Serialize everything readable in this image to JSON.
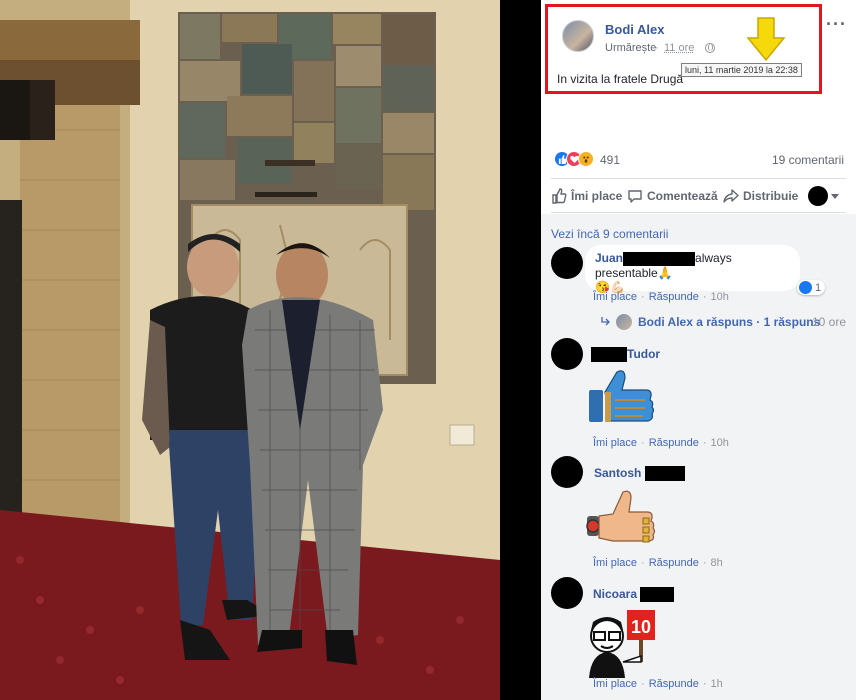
{
  "post": {
    "author": "Bodi Alex",
    "follow": "Urmărește",
    "dot": "·",
    "time": "11 ore",
    "tooltip": "luni, 11 martie 2019 la 22:38",
    "text": "In vizita la fratele Drugă"
  },
  "stats": {
    "reactions": "491",
    "comments": "19 comentarii"
  },
  "actions": {
    "like": "Îmi place",
    "comment": "Comentează",
    "share": "Distribuie"
  },
  "comments": {
    "see_more": "Vezi încă 9 comentarii",
    "c1": {
      "name": "Juan",
      "text": "always presentable🙏",
      "emoji": "😘💪🏻",
      "like": "Îmi place",
      "reply": "Răspunde",
      "age": "10h",
      "likes": "1"
    },
    "reply_row": {
      "text": "Bodi Alex a răspuns · 1 răspuns",
      "age": "10 ore"
    },
    "c2": {
      "name": "Tudor",
      "like": "Îmi place",
      "reply": "Răspunde",
      "age": "10h"
    },
    "c3": {
      "name": "Santosh",
      "like": "Îmi place",
      "reply": "Răspunde",
      "age": "8h"
    },
    "c4": {
      "name": "Nicoara",
      "like": "Îmi place",
      "reply": "Răspunde",
      "age": "1h",
      "sticker_text": "10"
    }
  },
  "colors": {
    "link": "#385898",
    "highlight": "#e0161e",
    "arrow": "#f5d90a"
  }
}
